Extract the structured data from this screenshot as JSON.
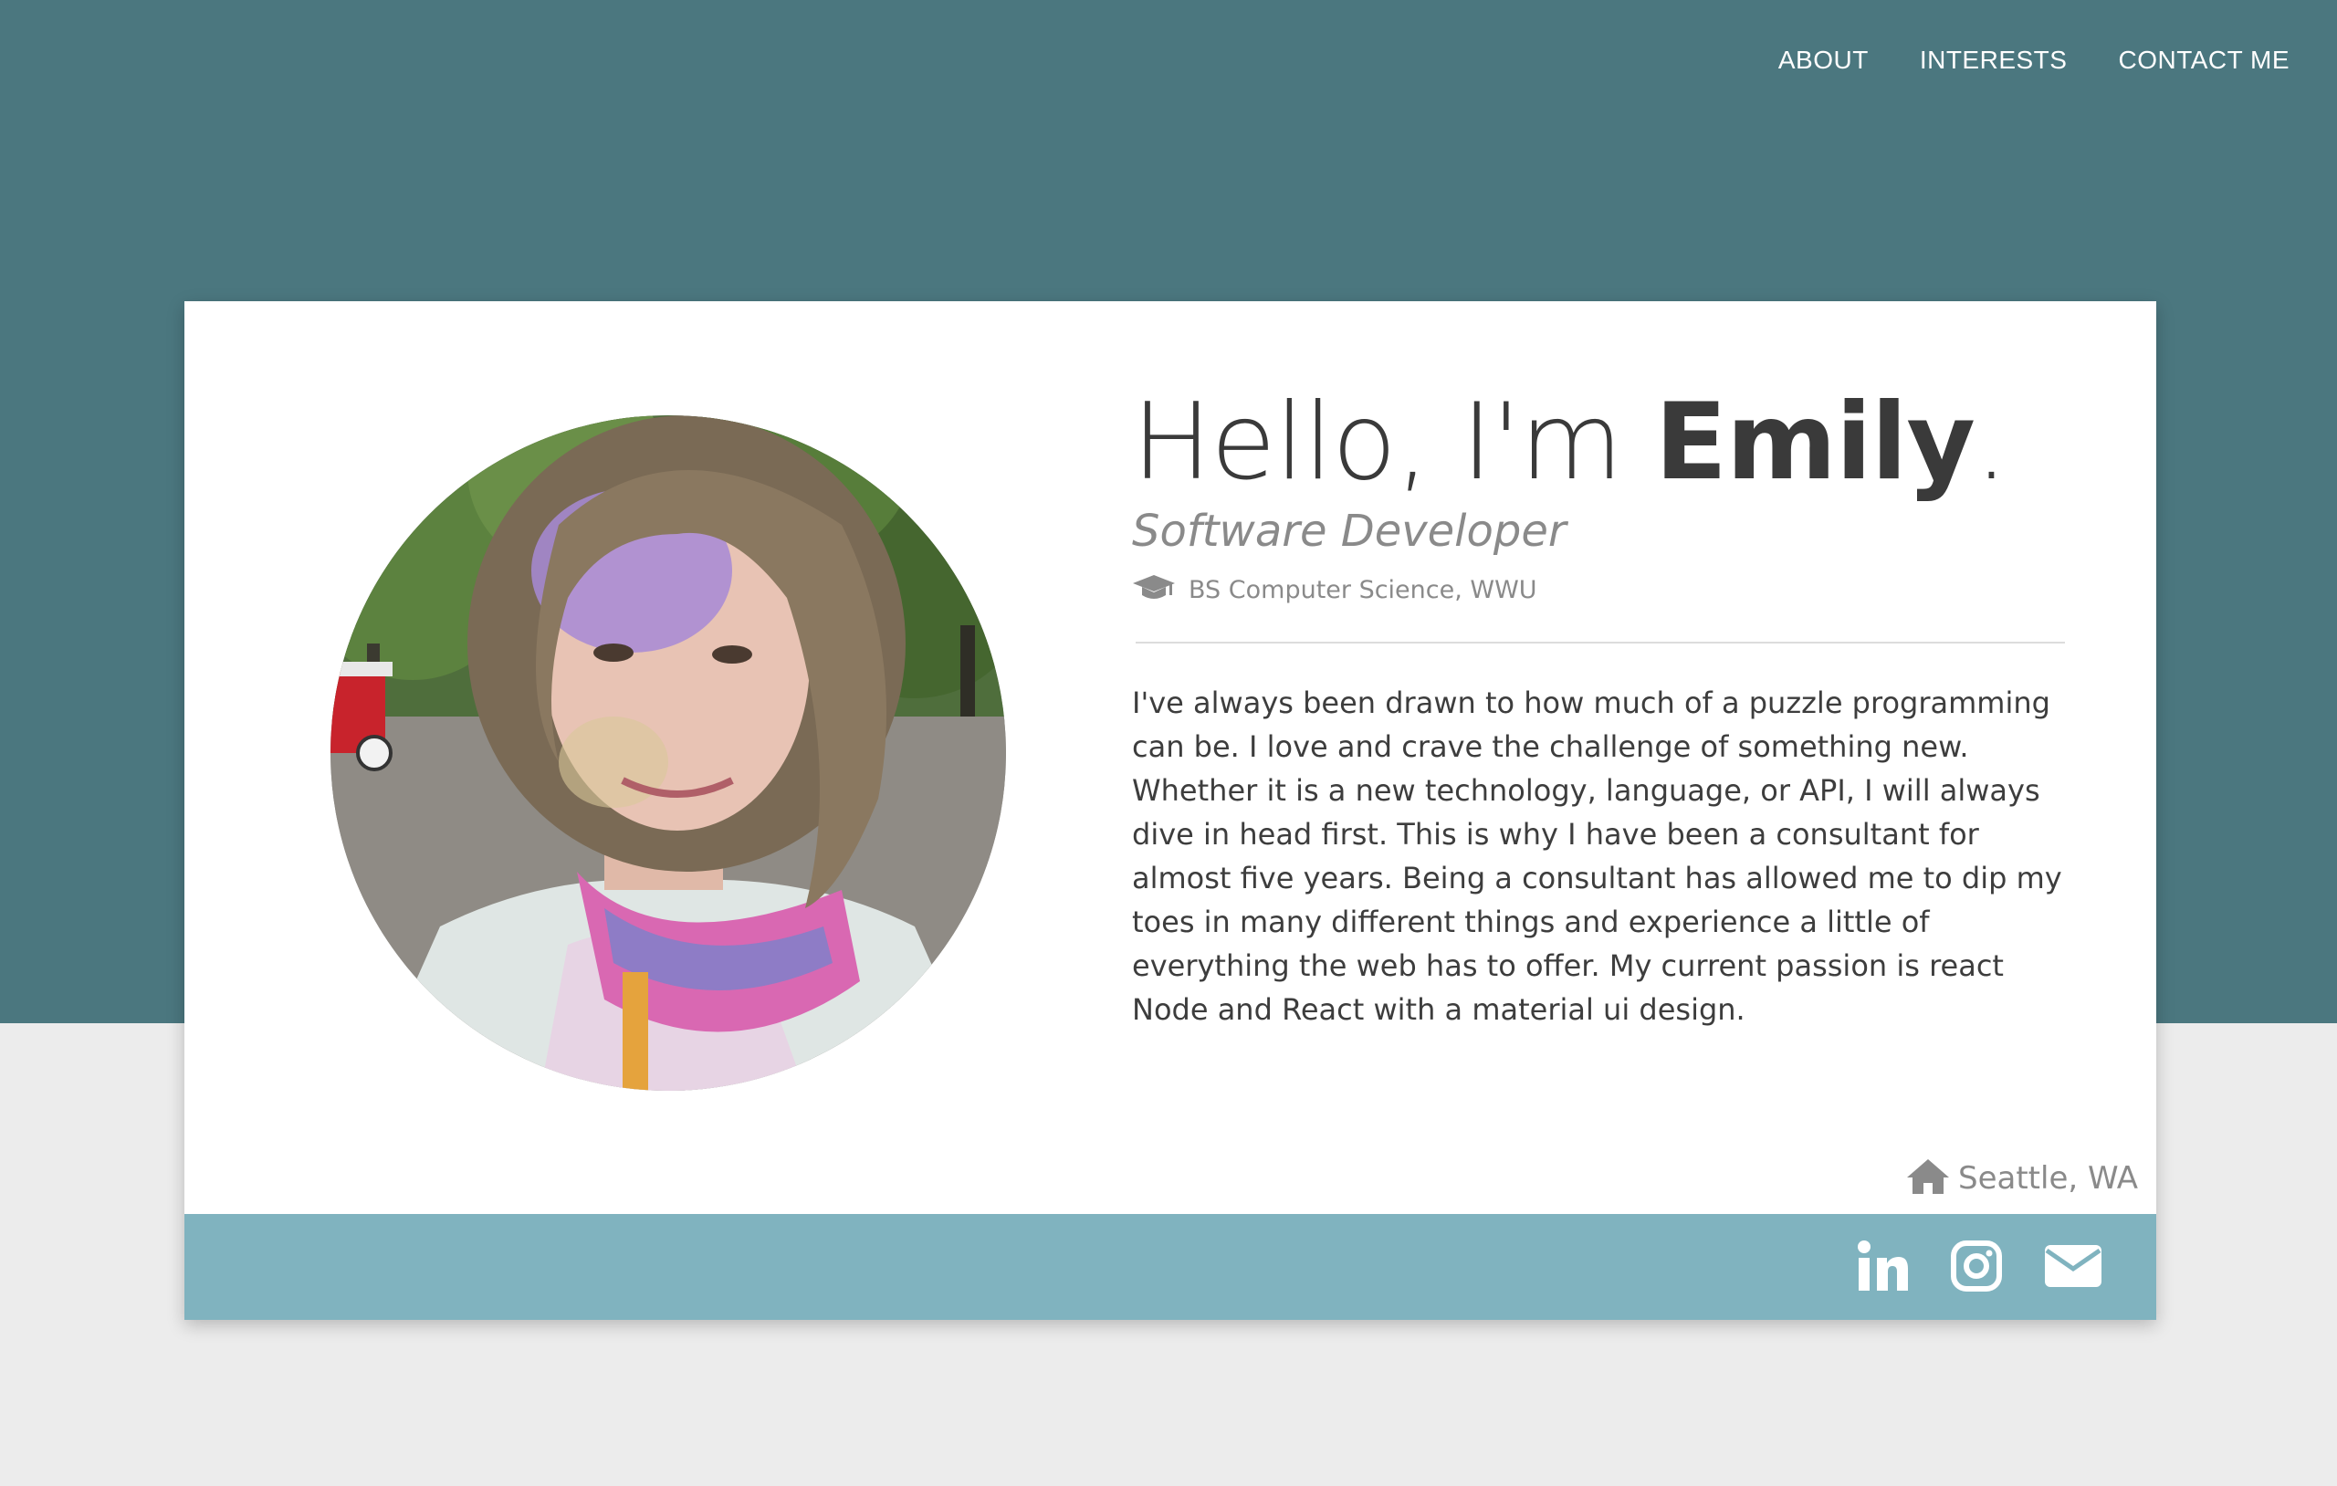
{
  "nav": {
    "items": [
      {
        "label": "ABOUT"
      },
      {
        "label": "INTERESTS"
      },
      {
        "label": "CONTACT ME"
      }
    ]
  },
  "profile": {
    "greeting_prefix": "Hello, I'm ",
    "name": "Emily",
    "greeting_suffix": ".",
    "role": "Software Developer",
    "education": "BS Computer Science, WWU",
    "bio": "I've always been drawn to how much of a puzzle programming can be. I love and crave the challenge of something new. Whether it is a new technology, language, or API, I will always dive in head first. This is why I have been a consultant for almost five years. Being a consultant has allowed me to dip my toes in many different things and experience a little of everything the web has to offer. My current passion is react Node and React with a material ui design.",
    "location": "Seattle, WA"
  },
  "icons": {
    "education": "graduation-cap-icon",
    "location": "home-icon",
    "social": [
      "linkedin-icon",
      "instagram-icon",
      "envelope-icon"
    ]
  },
  "colors": {
    "hero_background": "#4b777f",
    "page_background": "#ececec",
    "card_background": "#ffffff",
    "footer_background": "#80b3bf",
    "text_dark": "#3a3a3a",
    "text_muted": "#8a8a8a"
  }
}
